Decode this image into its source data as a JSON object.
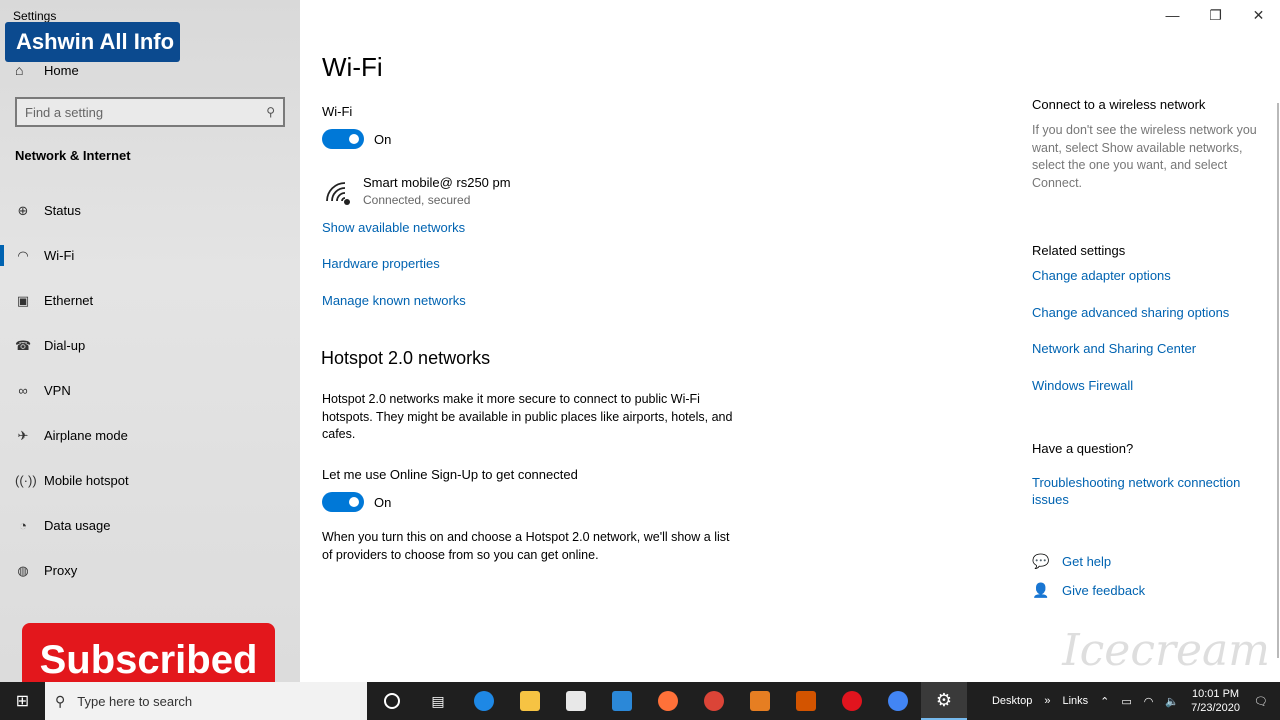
{
  "app": {
    "title": "Settings"
  },
  "overlay": {
    "banner": "Ashwin All Info",
    "subscribed": "Subscribed"
  },
  "sidebar": {
    "home": "Home",
    "search_placeholder": "Find a setting",
    "section": "Network & Internet",
    "items": [
      {
        "label": "Status",
        "icon": "status-icon"
      },
      {
        "label": "Wi-Fi",
        "icon": "wifi-icon",
        "active": true
      },
      {
        "label": "Ethernet",
        "icon": "ethernet-icon"
      },
      {
        "label": "Dial-up",
        "icon": "dialup-icon"
      },
      {
        "label": "VPN",
        "icon": "vpn-icon"
      },
      {
        "label": "Airplane mode",
        "icon": "airplane-icon"
      },
      {
        "label": "Mobile hotspot",
        "icon": "hotspot-icon"
      },
      {
        "label": "Data usage",
        "icon": "data-usage-icon"
      },
      {
        "label": "Proxy",
        "icon": "globe-icon"
      }
    ]
  },
  "main": {
    "title": "Wi-Fi",
    "wifi_label": "Wi-Fi",
    "wifi_state": "On",
    "network": {
      "name": "Smart mobile@ rs250 pm",
      "status": "Connected, secured"
    },
    "links": {
      "show_networks": "Show available networks",
      "hardware": "Hardware properties",
      "manage_known": "Manage known networks"
    },
    "hotspot": {
      "heading": "Hotspot 2.0 networks",
      "description": "Hotspot 2.0 networks make it more secure to connect to public Wi-Fi hotspots. They might be available in public places like airports, hotels, and cafes.",
      "signup_label": "Let me use Online Sign-Up to get connected",
      "signup_state": "On",
      "signup_description": "When you turn this on and choose a Hotspot 2.0 network, we'll show a list of providers to choose from so you can get online."
    }
  },
  "right": {
    "connect_heading": "Connect to a wireless network",
    "connect_text": "If you don't see the wireless network you want, select Show available networks, select the one you want, and select Connect.",
    "related_heading": "Related settings",
    "related_links": [
      "Change adapter options",
      "Change advanced sharing options",
      "Network and Sharing Center",
      "Windows Firewall"
    ],
    "question_heading": "Have a question?",
    "troubleshoot": "Troubleshooting network connection issues",
    "get_help": "Get help",
    "give_feedback": "Give feedback"
  },
  "taskbar": {
    "search_placeholder": "Type here to search",
    "desktop": "Desktop",
    "links": "Links",
    "time": "10:01 PM",
    "date": "7/23/2020",
    "apps": [
      {
        "name": "task-view",
        "color": "#ffffff"
      },
      {
        "name": "edge",
        "color": "#1e88e5"
      },
      {
        "name": "file-explorer",
        "color": "#f6c343"
      },
      {
        "name": "store",
        "color": "#e8e8e8"
      },
      {
        "name": "mail",
        "color": "#2b88d8"
      },
      {
        "name": "firefox",
        "color": "#ff7139"
      },
      {
        "name": "chrome",
        "color": "#db4437"
      },
      {
        "name": "app-orange-1",
        "color": "#e67e22"
      },
      {
        "name": "app-orange-2",
        "color": "#d35400"
      },
      {
        "name": "opera",
        "color": "#e1141e"
      },
      {
        "name": "chrome-2",
        "color": "#4285f4"
      },
      {
        "name": "settings",
        "color": "#9e9e9e"
      }
    ]
  },
  "watermark": "Icecream"
}
